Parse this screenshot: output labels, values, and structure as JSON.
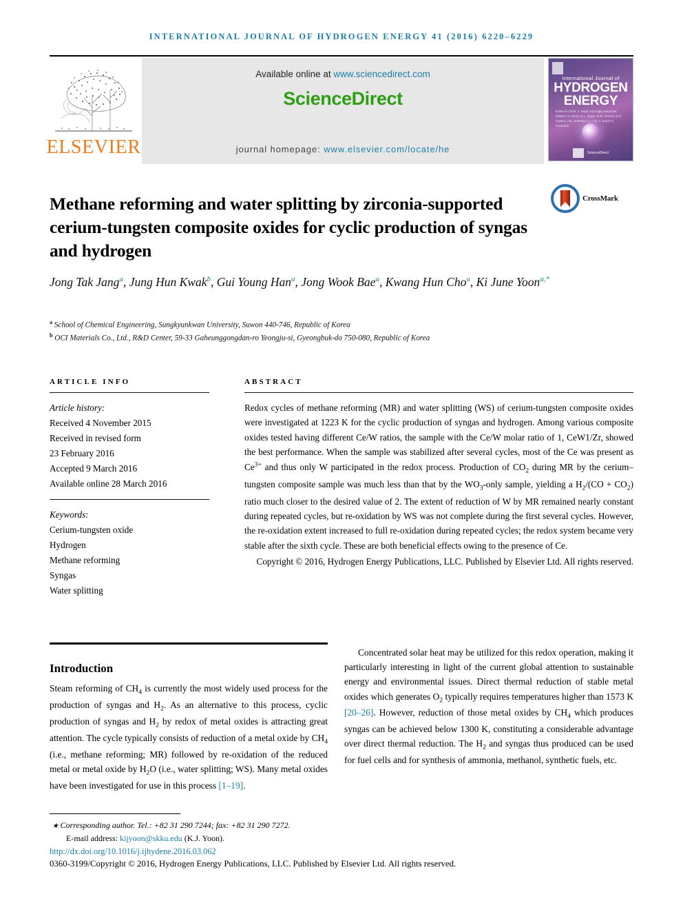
{
  "running_head": "INTERNATIONAL JOURNAL OF HYDROGEN ENERGY 41 (2016) 6220–6229",
  "masthead": {
    "publisher_name": "ELSEVIER",
    "available_prefix": "Available online at ",
    "available_url": "www.sciencedirect.com",
    "sciencedirect_logo": "ScienceDirect",
    "homepage_prefix": "journal homepage: ",
    "homepage_url": "www.elsevier.com/locate/he",
    "cover": {
      "subtitle": "International Journal of",
      "line1": "HYDROGEN",
      "line2": "ENERGY",
      "editors": "Editor-in-Chief: T. Nejat Veziroglu\nAssociate Editors: S. Dunn, D.L. Stojic, M.R. Ahmed,\nM.Z. Kazimi, J.M. Bellerby,\nL.L. Lin, T. and D.Y. Goswami",
      "footer_label": "ScienceDirect"
    }
  },
  "crossmark": {
    "label": "CrossMark"
  },
  "article": {
    "title": "Methane reforming and water splitting by zirconia-supported cerium-tungsten composite oxides for cyclic production of syngas and hydrogen",
    "authors": [
      {
        "name": "Jong Tak Jang",
        "aff": "a",
        "sep": ","
      },
      {
        "name": "Jung Hun Kwak",
        "aff": "b",
        "sep": ","
      },
      {
        "name": "Gui Young Han",
        "aff": "a",
        "sep": ","
      },
      {
        "name": "Jong Wook Bae",
        "aff": "a",
        "sep": ","
      },
      {
        "name": "Kwang Hun Cho",
        "aff": "a",
        "sep": ","
      },
      {
        "name": "Ki June Yoon",
        "aff": "a,*",
        "sep": ""
      }
    ],
    "affiliations": [
      {
        "marker": "a",
        "text": "School of Chemical Engineering, Sungkyunkwan University, Suwon 440-746, Republic of Korea"
      },
      {
        "marker": "b",
        "text": "OCI Materials Co., Ltd., R&D Center, 59-33 Gaheunggongdan-ro Yeongju-si, Gyeongbuk-do 750-080, Republic of Korea"
      }
    ]
  },
  "article_info": {
    "heading": "ARTICLE INFO",
    "history_label": "Article history:",
    "history": [
      "Received 4 November 2015",
      "Received in revised form",
      "23 February 2016",
      "Accepted 9 March 2016",
      "Available online 28 March 2016"
    ],
    "keywords_label": "Keywords:",
    "keywords": [
      "Cerium-tungsten oxide",
      "Hydrogen",
      "Methane reforming",
      "Syngas",
      "Water splitting"
    ]
  },
  "abstract": {
    "heading": "ABSTRACT",
    "p1_a": "Redox cycles of methane reforming (MR) and water splitting (WS) of cerium-tungsten composite oxides were investigated at 1223 K for the cyclic production of syngas and hydrogen. Among various composite oxides tested having different Ce/W ratios, the sample with the Ce/W molar ratio of 1, CeW1/Zr, showed the best performance. When the sample was stabilized after several cycles, most of the Ce was present as Ce",
    "ce_sup": "3+",
    "p1_b": " and thus only W participated in the redox process. Production of CO",
    "co2_sub": "2",
    "p1_c": " during MR by the cerium–tungsten composite sample was much less than that by the WO",
    "wo3_sub": "3",
    "p1_d": "-only sample, yielding a H",
    "h2_sub": "2",
    "p1_e": "/(CO + CO",
    "co2_sub2": "2",
    "p1_f": ") ratio much closer to the desired value of 2. The extent of reduction of W by MR remained nearly constant during repeated cycles, but re-oxidation by WS was not complete during the first several cycles. However, the re-oxidation extent increased to full re-oxidation during repeated cycles; the redox system became very stable after the sixth cycle. These are both beneficial effects owing to the presence of Ce.",
    "copyright": "Copyright © 2016, Hydrogen Energy Publications, LLC. Published by Elsevier Ltd. All rights reserved."
  },
  "introduction": {
    "heading": "Introduction",
    "left_a": "Steam reforming of CH",
    "ch4_sub": "4",
    "left_b": " is currently the most widely used process for the production of syngas and H",
    "h2_sub": "2",
    "left_c": ". As an alternative to this process, cyclic production of syngas and H",
    "h2_sub2": "2",
    "left_d": " by redox of metal oxides is attracting great attention. The cycle typically consists of reduction of a metal oxide by CH",
    "ch4_sub2": "4",
    "left_e": " (i.e., methane reforming; MR) followed by re-oxidation of the reduced metal or metal oxide by H",
    "h2o_sub": "2",
    "left_f": "O (i.e., water splitting; WS). Many metal oxides have been investigated for use in this process ",
    "ref_1_19": "[1–19]",
    "left_g": ".",
    "right_a": "Concentrated solar heat may be utilized for this redox operation, making it particularly interesting in light of the current global attention to sustainable energy and environmental issues. Direct thermal reduction of stable metal oxides which generates O",
    "o2_sub": "2",
    "right_b": " typically requires temperatures higher than 1573 K ",
    "ref_20_26": "[20–26]",
    "right_c": ". However, reduction of those metal oxides by CH",
    "ch4_sub3": "4",
    "right_d": " which produces syngas can be achieved below 1300 K, constituting a considerable advantage over direct thermal reduction. The H",
    "h2_sub3": "2",
    "right_e": " and syngas thus produced can be used for fuel cells and for synthesis of ammonia, methanol, synthetic fuels, etc."
  },
  "footer": {
    "corresponding_prefix": "Corresponding author. Tel.: +82 31 290 7244; fax: +82 31 290 7272.",
    "email_label": "E-mail address: ",
    "email": "kijyoon@skku.edu",
    "email_suffix": " (K.J. Yoon).",
    "doi": "http://dx.doi.org/10.1016/j.ijhydene.2016.03.062",
    "issn_line": "0360-3199/Copyright © 2016, Hydrogen Energy Publications, LLC. Published by Elsevier Ltd. All rights reserved."
  },
  "colors": {
    "link_blue": "#1b7fa8",
    "sciencedirect_green": "#2e9e13",
    "elsevier_orange": "#ef7c1a",
    "banner_gray": "#e7e7e7"
  }
}
